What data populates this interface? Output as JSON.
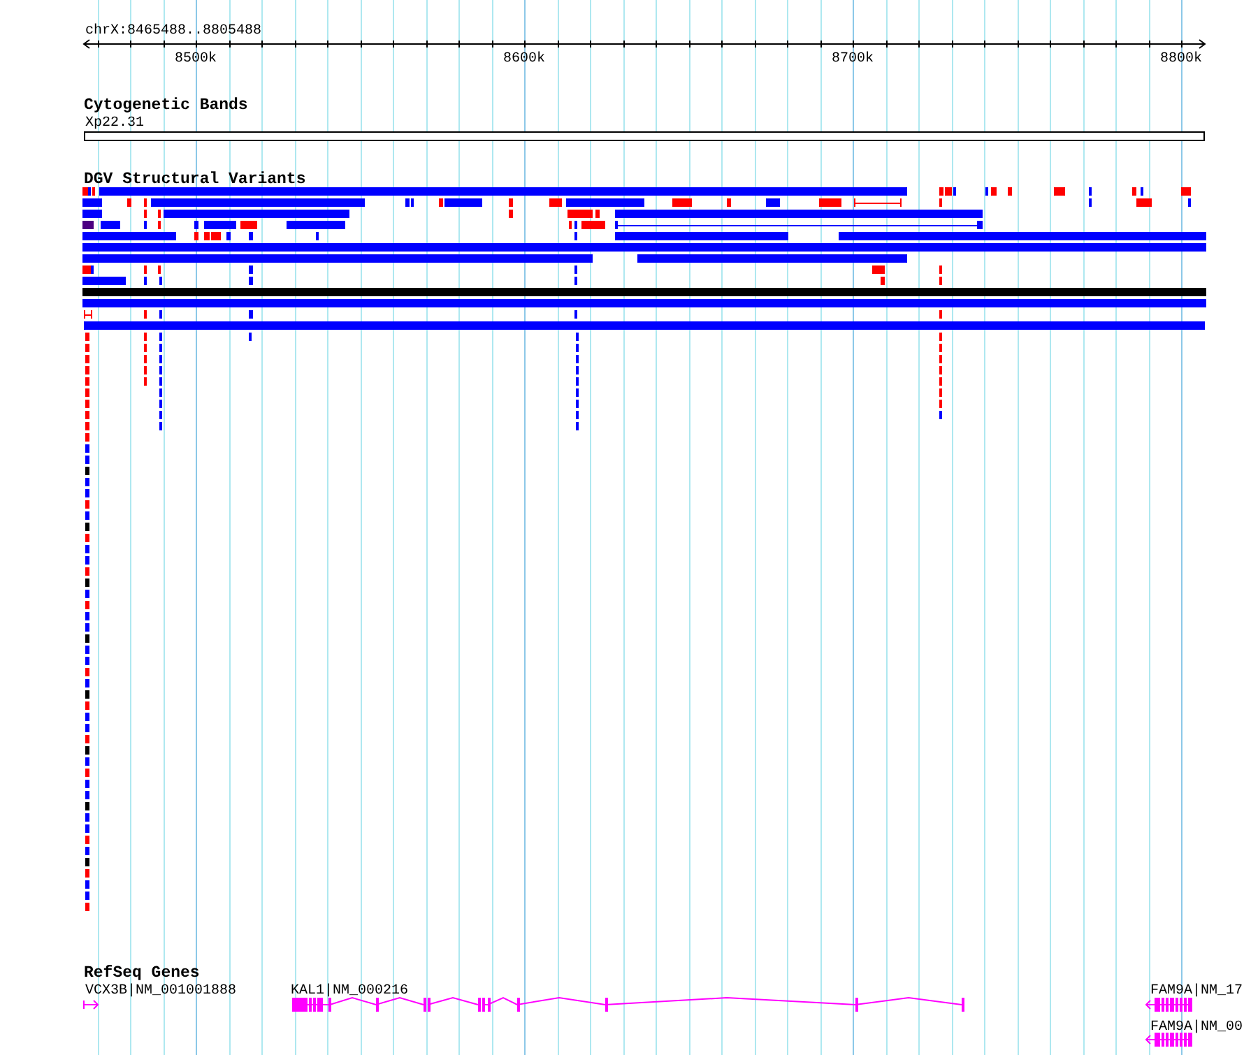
{
  "ruler": {
    "range": "chrX:8465488..8805488",
    "ticks": [
      "8500k",
      "8600k",
      "8700k",
      "8800k"
    ]
  },
  "tracks": [
    {
      "kind": "bands",
      "title": "Cytogenetic Bands",
      "bands": [
        "Xp22.31"
      ]
    },
    {
      "kind": "variants",
      "title": "DGV Structural Variants"
    },
    {
      "kind": "genes",
      "title": "RefSeq Genes",
      "genes": [
        {
          "label": "VCX3B|NM_001001888"
        },
        {
          "label": "KAL1|NM_000216"
        },
        {
          "label": "FAM9A|NM_17"
        },
        {
          "label": "FAM9A|NM_00"
        }
      ]
    }
  ]
}
